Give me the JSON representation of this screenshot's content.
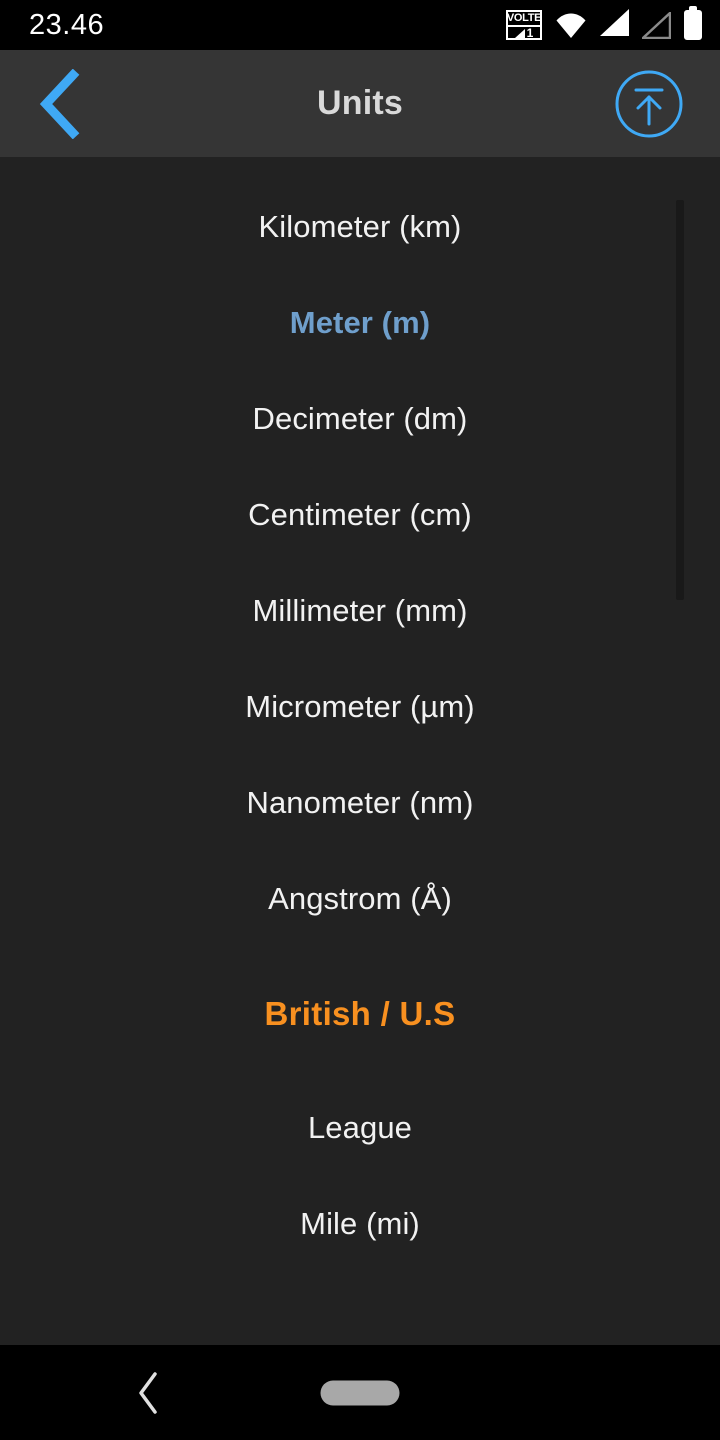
{
  "status_bar": {
    "time": "23.46",
    "icons": {
      "volte_label": "VOLTE",
      "volte_sim": "1",
      "wifi": "wifi-icon",
      "signal_1": "signal-full-icon",
      "signal_2": "signal-empty-icon",
      "battery": "battery-full-icon"
    }
  },
  "header": {
    "title": "Units",
    "back_icon": "chevron-left-icon",
    "scroll_top_icon": "upload-circle-icon"
  },
  "colors": {
    "accent_blue": "#3FA9F5",
    "selected_blue": "#6F9FCC",
    "section_orange": "#F89020",
    "header_bg": "#353535",
    "content_bg": "#222222",
    "text_primary": "#F2F2F2"
  },
  "list": {
    "items": [
      {
        "label": "Kilometer (km)",
        "type": "unit",
        "selected": false
      },
      {
        "label": "Meter (m)",
        "type": "unit",
        "selected": true
      },
      {
        "label": "Decimeter (dm)",
        "type": "unit",
        "selected": false
      },
      {
        "label": "Centimeter (cm)",
        "type": "unit",
        "selected": false
      },
      {
        "label": "Millimeter (mm)",
        "type": "unit",
        "selected": false
      },
      {
        "label": "Micrometer (µm)",
        "type": "unit",
        "selected": false
      },
      {
        "label": "Nanometer (nm)",
        "type": "unit",
        "selected": false
      },
      {
        "label": "Angstrom (Å)",
        "type": "unit",
        "selected": false
      },
      {
        "label": "British / U.S",
        "type": "section",
        "selected": false
      },
      {
        "label": "League",
        "type": "unit",
        "selected": false
      },
      {
        "label": "Mile (mi)",
        "type": "unit",
        "selected": false
      }
    ]
  },
  "nav_bar": {
    "back_icon": "chevron-left-icon",
    "home_handle": "home-pill-handle"
  }
}
